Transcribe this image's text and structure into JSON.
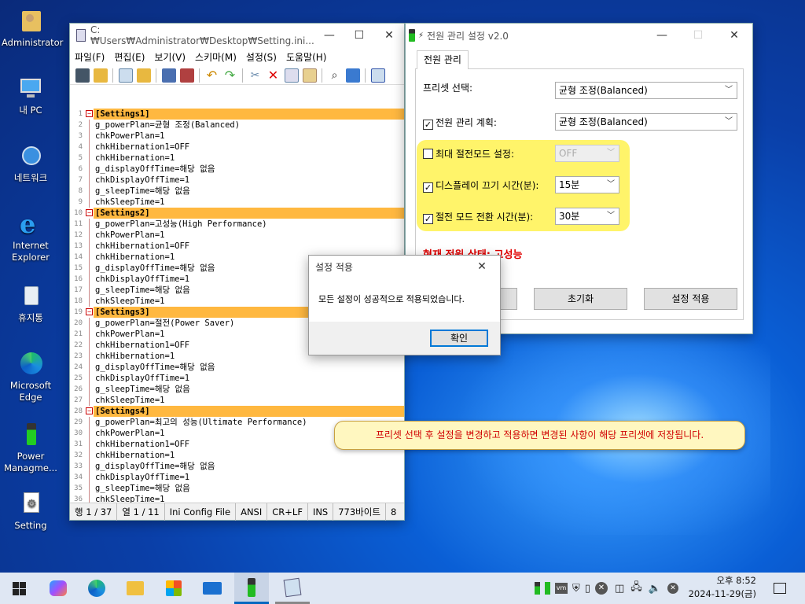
{
  "desktop": {
    "icons": [
      {
        "label": "Administrator"
      },
      {
        "label": "내 PC"
      },
      {
        "label": "네트워크"
      },
      {
        "label": "Internet Explorer"
      },
      {
        "label": "휴지통"
      },
      {
        "label": "Microsoft Edge"
      },
      {
        "label": "Power Managme..."
      },
      {
        "label": "Setting"
      }
    ]
  },
  "editor": {
    "title": "C:₩Users₩Administrator₩Desktop₩Setting.ini...",
    "menu": [
      "파일(F)",
      "편집(E)",
      "보기(V)",
      "스키마(M)",
      "설정(S)",
      "도움말(H)"
    ],
    "lines": [
      "[Settings1]",
      "g_powerPlan=균형 조정(Balanced)",
      "chkPowerPlan=1",
      "chkHibernation1=OFF",
      "chkHibernation=1",
      "g_displayOffTime=해당 없음",
      "chkDisplayOffTime=1",
      "g_sleepTime=해당 없음",
      "chkSleepTime=1",
      "[Settings2]",
      "g_powerPlan=고성능(High Performance)",
      "chkPowerPlan=1",
      "chkHibernation1=OFF",
      "chkHibernation=1",
      "g_displayOffTime=해당 없음",
      "chkDisplayOffTime=1",
      "g_sleepTime=해당 없음",
      "chkSleepTime=1",
      "[Settings3]",
      "g_powerPlan=절전(Power Saver)",
      "chkPowerPlan=1",
      "chkHibernation1=OFF",
      "chkHibernation=1",
      "g_displayOffTime=해당 없음",
      "chkDisplayOffTime=1",
      "g_sleepTime=해당 없음",
      "chkSleepTime=1",
      "[Settings4]",
      "g_powerPlan=최고의 성능(Ultimate Performance)",
      "chkPowerPlan=1",
      "chkHibernation1=OFF",
      "chkHibernation=1",
      "g_displayOffTime=해당 없음",
      "chkDisplayOffTime=1",
      "g_sleepTime=해당 없음",
      "chkSleepTime=1",
      ""
    ],
    "status": {
      "position": "행 1 / 37",
      "column": "열 1 / 11",
      "filetype": "Ini Config File",
      "encoding": "ANSI",
      "eol": "CR+LF",
      "mode": "INS",
      "size": "773바이트",
      "extra": "8"
    }
  },
  "power": {
    "title": "전원 관리 설정 v2.0",
    "tab": "전원 관리",
    "preset_label": "프리셋 선택:",
    "preset_value": "균형 조정(Balanced)",
    "plan_label": "전원 관리 계획:",
    "plan_value": "균형 조정(Balanced)",
    "hibernate_label": "최대 절전모드 설정:",
    "hibernate_value": "OFF",
    "display_label": "디스플레이 끄기 시간(분):",
    "display_value": "15분",
    "sleep_label": "절전 모드 전환 시간(분):",
    "sleep_value": "30분",
    "status_text": "현재 전원 상태: 고성능",
    "reset_button": "초기화",
    "apply_button": "설정 적용",
    "accent": "#e00000"
  },
  "dialog": {
    "title": "설정 적용",
    "message": "모든 설정이 성공적으로 적용되었습니다.",
    "ok": "확인"
  },
  "tooltip": {
    "text": "프리셋 선택 후 설정을 변경하고 적용하면 변경된 사항이 해당 프리셋에 저장됩니다."
  },
  "taskbar": {
    "time": "오후 8:52",
    "date": "2024-11-29(금)"
  }
}
